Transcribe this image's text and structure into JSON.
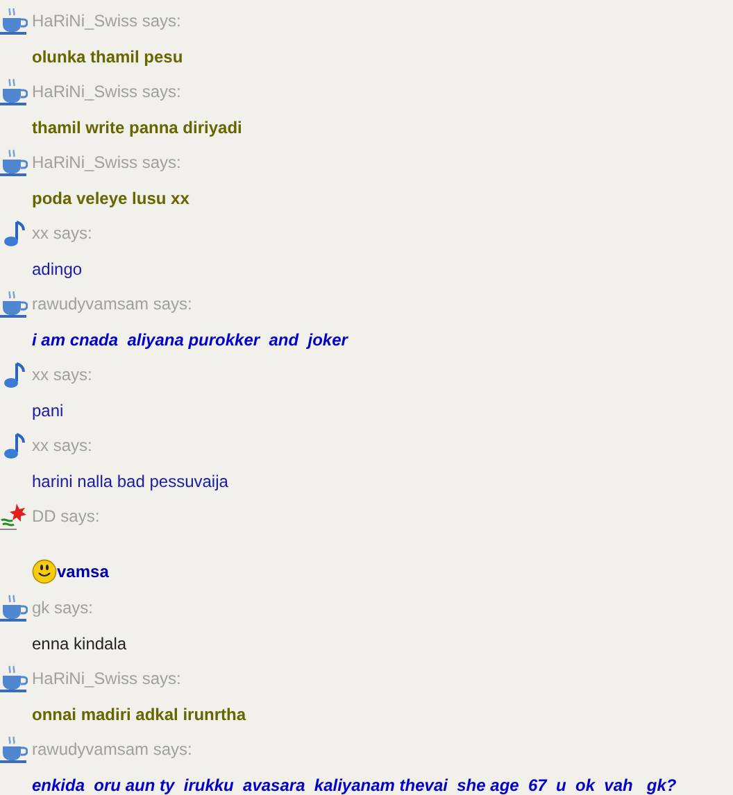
{
  "messages": [
    {
      "sender": "HaRiNi_Swiss says:",
      "avatar": {
        "kind": "cup"
      },
      "text": "olunka thamil pesu",
      "color": "#666600",
      "bold": true,
      "italic": false
    },
    {
      "sender": "HaRiNi_Swiss says:",
      "avatar": {
        "kind": "cup"
      },
      "text": "thamil write panna diriyadi",
      "color": "#666600",
      "bold": true,
      "italic": false
    },
    {
      "sender": "HaRiNi_Swiss says:",
      "avatar": {
        "kind": "cup"
      },
      "text": "poda veleye lusu xx",
      "color": "#666600",
      "bold": true,
      "italic": false
    },
    {
      "sender": "xx says:",
      "avatar": {
        "kind": "note"
      },
      "text": "adingo",
      "color": "#1a1aa8",
      "bold": false,
      "italic": false
    },
    {
      "sender": "rawudyvamsam says:",
      "avatar": {
        "kind": "cup"
      },
      "text": "i am cnada  aliyana purokker  and  joker",
      "color": "#0000cc",
      "bold": true,
      "italic": true
    },
    {
      "sender": "xx says:",
      "avatar": {
        "kind": "note"
      },
      "text": "pani",
      "color": "#1a1aa8",
      "bold": false,
      "italic": false
    },
    {
      "sender": "xx says:",
      "avatar": {
        "kind": "note"
      },
      "text": "harini nalla bad pessuvaija",
      "color": "#1a1aa8",
      "bold": false,
      "italic": false
    },
    {
      "sender": "DD says:",
      "avatar": {
        "kind": "flag"
      },
      "emoticon": {
        "kind": "smile"
      },
      "text": "vamsa",
      "color": "#0000aa",
      "bold": true,
      "italic": false
    },
    {
      "sender": "gk says:",
      "avatar": {
        "kind": "cup"
      },
      "text": "enna kindala",
      "color": "#222222",
      "bold": false,
      "italic": false
    },
    {
      "sender": "HaRiNi_Swiss says:",
      "avatar": {
        "kind": "cup"
      },
      "text": "onnai madiri adkal irunrtha",
      "color": "#666600",
      "bold": true,
      "italic": false
    },
    {
      "sender": "rawudyvamsam says:",
      "avatar": {
        "kind": "cup"
      },
      "text": "enkida  oru aun ty  irukku  avasara  kaliyanam thevai  she age  67  u  ok  vah   gk?",
      "color": "#0000cc",
      "bold": true,
      "italic": true
    }
  ]
}
